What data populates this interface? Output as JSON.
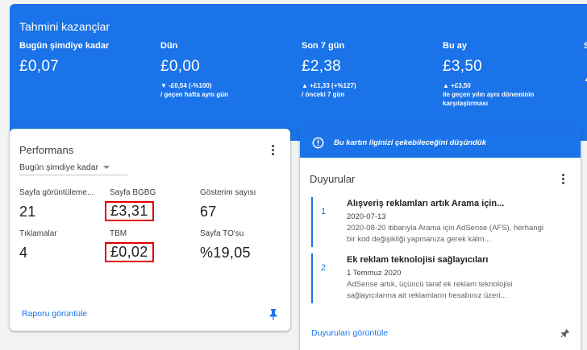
{
  "earnings": {
    "title": "Tahmini kazançlar",
    "columns": [
      {
        "label": "Bugün şimdiye kadar",
        "value": "£0,07",
        "change": "",
        "compare": ""
      },
      {
        "label": "Dün",
        "value": "£0,00",
        "change": "▼ -£0,54 (-%100)",
        "compare": "/ geçen hafta aynı gün"
      },
      {
        "label": "Son 7 gün",
        "value": "£2,38",
        "change": "▲ +£1,33 (+%127)",
        "compare": "/ önceki 7 gün"
      },
      {
        "label": "Bu ay",
        "value": "£3,50",
        "change": "▲ +£3,50",
        "compare": "ile geçen yılın aynı döneminin karşılaştırması"
      },
      {
        "label": "S",
        "value": "",
        "change": "▲",
        "compare": ""
      }
    ]
  },
  "performance": {
    "title": "Performans",
    "period": "Bugün şimdiye kadar",
    "metrics": [
      {
        "label": "Sayfa görüntüleme...",
        "value": "21"
      },
      {
        "label": "Sayfa BGBG",
        "value": "£3,31"
      },
      {
        "label": "Gösterim sayısı",
        "value": "67"
      },
      {
        "label": "Tıklamalar",
        "value": "4"
      },
      {
        "label": "TBM",
        "value": "£0,02"
      },
      {
        "label": "Sayfa TO'su",
        "value": "%19,05"
      }
    ],
    "link": "Raporu görüntüle"
  },
  "announcements": {
    "banner": "Bu kartın ilginizi çekebileceğini düşündük",
    "title": "Duyurular",
    "items": [
      {
        "num": "1",
        "headline": "Alışveriş reklamları artık Arama için...",
        "date": "2020-07-13",
        "body": "2020-08-20 itibarıyla Arama için AdSense (AFS), herhangi bir kod değişikliği yapmanıza gerek kalm..."
      },
      {
        "num": "2",
        "headline": "Ek reklam teknolojisi sağlayıcıları",
        "date": "1 Temmuz 2020",
        "body": "AdSense artık, üçüncü taraf ek reklam teknolojisi sağlayıcılarına ait reklamların hesabınız üzeri..."
      }
    ],
    "link": "Duyuruları görüntüle"
  },
  "colors": {
    "accent": "#1a73e8",
    "highlight": "#e00000"
  }
}
